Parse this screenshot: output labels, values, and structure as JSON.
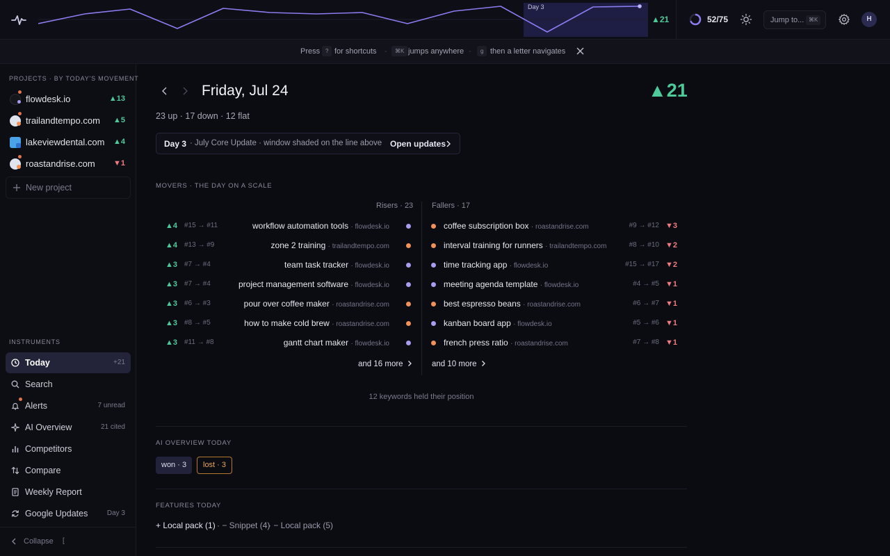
{
  "topbar": {
    "chart_day_label": "Day 3",
    "delta": "▲21",
    "quota": "52/75",
    "jump_label": "Jump to...",
    "jump_shortcut": "⌘K",
    "avatar_initial": "H"
  },
  "tips": {
    "press": "Press",
    "key_help": "?",
    "for_shortcuts": "for shortcuts",
    "dot": "·",
    "key_jump": "⌘K",
    "jumps_anywhere": "jumps anywhere",
    "key_g": "g",
    "then_letter": "then a letter navigates"
  },
  "sidebar": {
    "projects_label": "PROJECTS · BY TODAY'S MOVEMENT",
    "projects": [
      {
        "name": "flowdesk.io",
        "delta": "▲13"
      },
      {
        "name": "trailandtempo.com",
        "delta": "▲5"
      },
      {
        "name": "lakeviewdental.com",
        "delta": "▲4"
      },
      {
        "name": "roastandrise.com",
        "delta": "▼1"
      }
    ],
    "new_project": "New project",
    "instruments_label": "INSTRUMENTS",
    "instruments": [
      {
        "name": "Today",
        "meta": "+21"
      },
      {
        "name": "Search",
        "meta": ""
      },
      {
        "name": "Alerts",
        "meta": "7 unread"
      },
      {
        "name": "AI Overview",
        "meta": "21 cited"
      },
      {
        "name": "Competitors",
        "meta": ""
      },
      {
        "name": "Compare",
        "meta": ""
      },
      {
        "name": "Weekly Report",
        "meta": ""
      },
      {
        "name": "Google Updates",
        "meta": "Day 3"
      }
    ],
    "collapse": "Collapse",
    "collapse_key": "["
  },
  "main": {
    "date": "Friday, Jul 24",
    "delta": "▲21",
    "summary": "23 up · 17 down · 12 flat",
    "update_day": "Day 3",
    "update_desc": "· July Core Update · window shaded on the line above",
    "update_link": "Open updates",
    "movers_label": "MOVERS · THE DAY ON A SCALE",
    "risers_header": "Risers · 23",
    "fallers_header": "Fallers · 17",
    "risers": [
      {
        "delta": "▲4",
        "rank": "#15 → #11",
        "keyword": "workflow automation tools",
        "domain": "· flowdesk.io",
        "color": "#a99bf0"
      },
      {
        "delta": "▲4",
        "rank": "#13 → #9",
        "keyword": "zone 2 training",
        "domain": "· trailandtempo.com",
        "color": "#f0915a"
      },
      {
        "delta": "▲3",
        "rank": "#7 → #4",
        "keyword": "team task tracker",
        "domain": "· flowdesk.io",
        "color": "#a99bf0"
      },
      {
        "delta": "▲3",
        "rank": "#7 → #4",
        "keyword": "project management software",
        "domain": "· flowdesk.io",
        "color": "#a99bf0"
      },
      {
        "delta": "▲3",
        "rank": "#6 → #3",
        "keyword": "pour over coffee maker",
        "domain": "· roastandrise.com",
        "color": "#f0915a"
      },
      {
        "delta": "▲3",
        "rank": "#8 → #5",
        "keyword": "how to make cold brew",
        "domain": "· roastandrise.com",
        "color": "#f0915a"
      },
      {
        "delta": "▲3",
        "rank": "#11 → #8",
        "keyword": "gantt chart maker",
        "domain": "· flowdesk.io",
        "color": "#a99bf0"
      }
    ],
    "fallers": [
      {
        "delta": "▼3",
        "rank": "#9 → #12",
        "keyword": "coffee subscription box",
        "domain": "· roastandrise.com",
        "color": "#f0915a"
      },
      {
        "delta": "▼2",
        "rank": "#8 → #10",
        "keyword": "interval training for runners",
        "domain": "· trailandtempo.com",
        "color": "#f0915a"
      },
      {
        "delta": "▼2",
        "rank": "#15 → #17",
        "keyword": "time tracking app",
        "domain": "· flowdesk.io",
        "color": "#a99bf0"
      },
      {
        "delta": "▼1",
        "rank": "#4 → #5",
        "keyword": "meeting agenda template",
        "domain": "· flowdesk.io",
        "color": "#a99bf0"
      },
      {
        "delta": "▼1",
        "rank": "#6 → #7",
        "keyword": "best espresso beans",
        "domain": "· roastandrise.com",
        "color": "#f0915a"
      },
      {
        "delta": "▼1",
        "rank": "#5 → #6",
        "keyword": "kanban board app",
        "domain": "· flowdesk.io",
        "color": "#a99bf0"
      },
      {
        "delta": "▼1",
        "rank": "#7 → #8",
        "keyword": "french press ratio",
        "domain": "· roastandrise.com",
        "color": "#f0915a"
      }
    ],
    "risers_more": "and 16 more",
    "fallers_more": "and 10 more",
    "held": "12 keywords held their position",
    "ai_label": "AI OVERVIEW TODAY",
    "ai_won": "won · 3",
    "ai_lost": "lost · 3",
    "features_label": "FEATURES TODAY",
    "feature_gain": "+ Local pack (1)",
    "feature_loss_1": "· − Snippet (4)",
    "feature_loss_2": "· − Local pack (5)"
  },
  "colors": {
    "accent": "#8b7cf0",
    "up": "#4ec99a",
    "down": "#f07a82",
    "lost": "#e8a755"
  }
}
